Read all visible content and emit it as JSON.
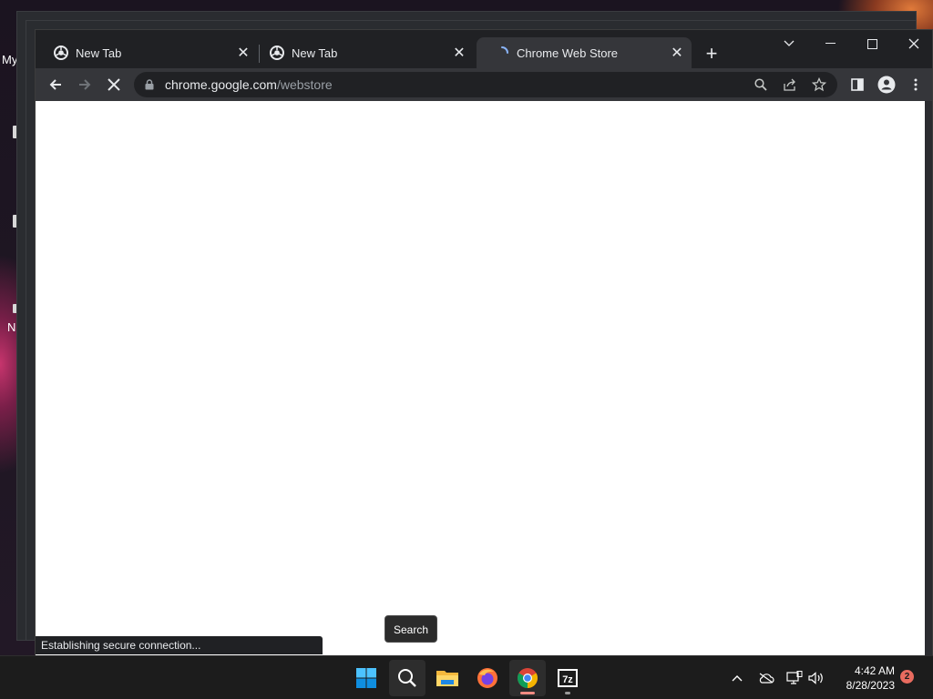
{
  "desktop": {
    "labels": [
      "My",
      "N"
    ]
  },
  "browser": {
    "tabs": [
      {
        "title": "New Tab",
        "icon": "chrome-icon",
        "active": false
      },
      {
        "title": "New Tab",
        "icon": "chrome-icon",
        "active": false
      },
      {
        "title": "Chrome Web Store",
        "icon": "loading-spinner-icon",
        "active": true
      }
    ],
    "url_host": "chrome.google.com",
    "url_path": "/webstore",
    "status_text": "Establishing secure connection..."
  },
  "tooltip": {
    "text": "Search"
  },
  "taskbar": {
    "apps": [
      "windows-start-icon",
      "search-icon",
      "file-explorer-icon",
      "firefox-icon",
      "chrome-icon",
      "7zip-icon"
    ],
    "time": "4:42 AM",
    "date": "8/28/2023",
    "notification_count": "2"
  },
  "colors": {
    "accent_chrome_tab": "#35363a",
    "taskbar": "#1c1c1c",
    "badge": "#e86b5f"
  }
}
